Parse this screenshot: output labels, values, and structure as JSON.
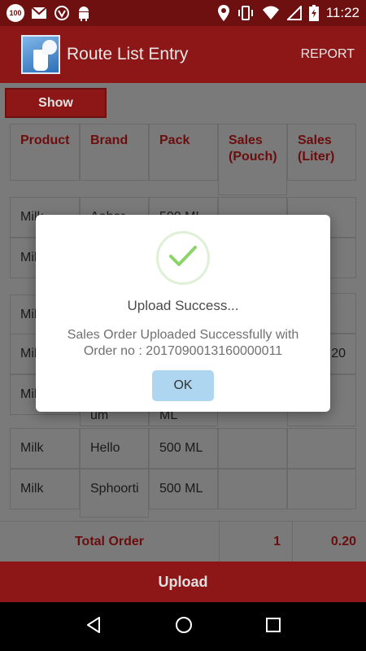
{
  "status_bar": {
    "badge": "100",
    "time": "11:22",
    "icons": [
      "notification-100-icon",
      "gmail-icon",
      "shield-v-icon",
      "android-icon",
      "location-icon",
      "vibrate-icon",
      "wifi-icon",
      "signal-icon",
      "battery-charging-icon"
    ]
  },
  "app_bar": {
    "title": "Route List Entry",
    "report_label": "REPORT",
    "logo_icon": "milk-logo-icon"
  },
  "content": {
    "show_label": "Show",
    "table": {
      "headers": [
        "Product",
        "Brand",
        "Pack",
        "Sales (Pouch)",
        "Sales (Liter)"
      ],
      "rows": [
        [
          "Milk",
          "Aabar",
          "500 ML",
          "",
          ""
        ],
        [
          "Milk",
          "",
          "",
          "",
          ""
        ],
        [
          "Milk",
          "",
          "",
          "",
          ""
        ],
        [
          "Milk",
          "",
          "",
          "",
          "0.20"
        ],
        [
          "Milk",
          "um",
          "ML",
          "",
          ""
        ],
        [
          "Milk",
          "Hello",
          "500 ML",
          "",
          ""
        ],
        [
          "Milk",
          "Sphoorti",
          "500 ML",
          "",
          ""
        ]
      ]
    },
    "total": {
      "label": "Total Order",
      "pouch": "1",
      "liter": "0.20"
    },
    "upload_label": "Upload"
  },
  "dialog": {
    "title": "Upload Success...",
    "message": "Sales Order Uploaded Successfully with Order no : 2017090013160000011",
    "ok_label": "OK",
    "icon": "check-icon"
  },
  "nav_bar": {
    "icons": [
      "back-icon",
      "home-icon",
      "recents-icon"
    ]
  },
  "colors": {
    "primary": "#8d1717",
    "status_bar": "#6e1010",
    "dim_overlay": "#7a7a7a",
    "ok_button": "#aed6f1",
    "check_green": "#8cd46a"
  }
}
